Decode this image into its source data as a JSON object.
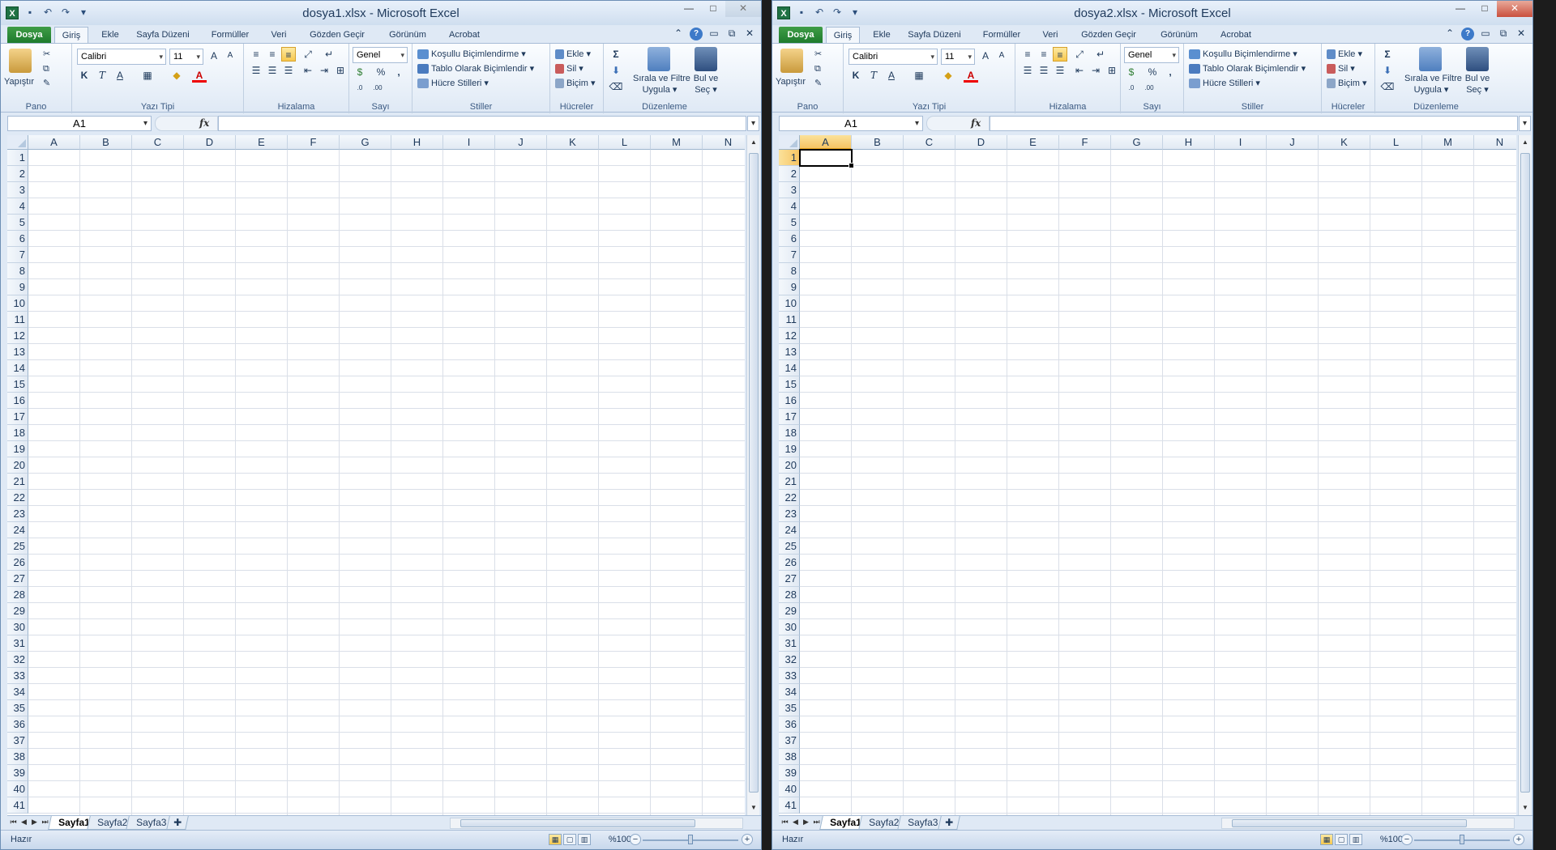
{
  "windows": [
    {
      "id": "left",
      "title": "dosya1.xlsx  -  Microsoft Excel",
      "selected_cell_visible": false,
      "name_box": "A1",
      "active_sheet": "Sayfa1"
    },
    {
      "id": "right",
      "title": "dosya2.xlsx  -  Microsoft Excel",
      "selected_cell_visible": true,
      "name_box": "A1",
      "active_sheet": "Sayfa1"
    }
  ],
  "tabs": [
    "Dosya",
    "Giriş",
    "Ekle",
    "Sayfa Düzeni",
    "Formüller",
    "Veri",
    "Gözden Geçir",
    "Görünüm",
    "Acrobat"
  ],
  "ribbon": {
    "pano": {
      "label": "Pano",
      "paste": "Yapıştır"
    },
    "font": {
      "label": "Yazı Tipi",
      "name": "Calibri",
      "size": "11",
      "bold": "K",
      "italic": "T",
      "underline": "A"
    },
    "align": {
      "label": "Hizalama"
    },
    "number": {
      "label": "Sayı",
      "format": "Genel",
      "percent": "%",
      "comma": ","
    },
    "styles": {
      "label": "Stiller",
      "conditional": "Koşullu Biçimlendirme",
      "table": "Tablo Olarak Biçimlendir",
      "cell": "Hücre Stilleri"
    },
    "cells": {
      "label": "Hücreler",
      "insert": "Ekle",
      "delete": "Sil",
      "format": "Biçim"
    },
    "editing": {
      "label": "Düzenleme",
      "sort1": "Sırala ve Filtre",
      "sort2": "Uygula",
      "find1": "Bul ve",
      "find2": "Seç",
      "sigma": "Σ"
    }
  },
  "formula_bar": {
    "fx": "fx"
  },
  "columns": [
    "A",
    "B",
    "C",
    "D",
    "E",
    "F",
    "G",
    "H",
    "I",
    "J",
    "K",
    "L",
    "M",
    "N"
  ],
  "rows": [
    "1",
    "2",
    "3",
    "4",
    "5",
    "6",
    "7",
    "8",
    "9",
    "10",
    "11",
    "12",
    "13",
    "14",
    "15",
    "16",
    "17",
    "18",
    "19",
    "20",
    "21",
    "22",
    "23",
    "24",
    "25",
    "26",
    "27",
    "28",
    "29",
    "30",
    "31",
    "32",
    "33",
    "34",
    "35",
    "36",
    "37",
    "38",
    "39",
    "40",
    "41"
  ],
  "sheets": [
    "Sayfa1",
    "Sayfa2",
    "Sayfa3"
  ],
  "status": {
    "ready": "Hazır",
    "zoom": "%100"
  },
  "colors": {
    "accent": "#1f7244",
    "file_tab": "#2e8b3a",
    "selection": "#f6c463"
  }
}
